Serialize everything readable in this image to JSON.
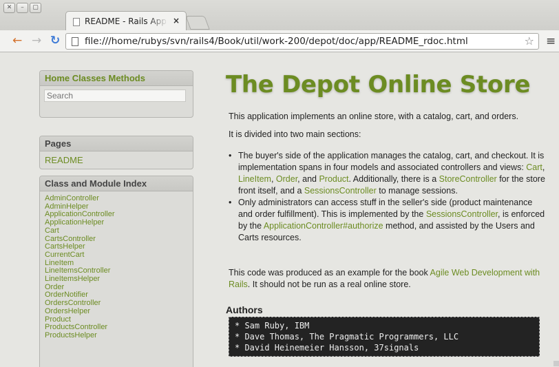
{
  "browser": {
    "window_controls": [
      "✕",
      "–",
      "▢"
    ],
    "tab_title": "README - Rails Applicatio",
    "tab_close": "×",
    "url": "file:///home/rubys/svn/rails4/Book/util/work-200/depot/doc/app/README_rdoc.html",
    "back_glyph": "←",
    "forward_glyph": "→",
    "reload_glyph": "↻",
    "star_glyph": "☆",
    "menu_glyph": "≡"
  },
  "sidebar": {
    "nav_title": "Home Classes Methods",
    "search_placeholder": "Search",
    "pages_title": "Pages",
    "pages": [
      "README"
    ],
    "index_title": "Class and Module Index",
    "classes": [
      "AdminController",
      "AdminHelper",
      "ApplicationController",
      "ApplicationHelper",
      "Cart",
      "CartsController",
      "CartsHelper",
      "CurrentCart",
      "LineItem",
      "LineItemsController",
      "LineItemsHelper",
      "Order",
      "OrderNotifier",
      "OrdersController",
      "OrdersHelper",
      "Product",
      "ProductsController",
      "ProductsHelper"
    ]
  },
  "main": {
    "title": "The Depot Online Store",
    "intro": "This application implements an online store, with a catalog, cart, and orders.",
    "divided": "It is divided into two main sections:",
    "bullet1": {
      "t1": "The buyer's side of the application manages the catalog, cart, and checkout. It is implementation spans in four models and associated controllers and views: ",
      "link_cart": "Cart",
      "sep1": ", ",
      "link_lineitem": "LineItem",
      "sep2": ", ",
      "link_order": "Order",
      "sep3": ", and ",
      "link_product": "Product",
      "t2": ". Additionally, there is a ",
      "link_storecontroller": "StoreController",
      "t3": " for the store front itself, and a ",
      "link_sessionscontroller": "SessionsController",
      "t4": " to manage sessions."
    },
    "bullet2": {
      "t1": "Only administrators can access stuff in the seller's side (product maintenance and order fulfillment). This is implemented by the ",
      "link_sessionscontroller": "SessionsController",
      "t2": ", is enforced by the ",
      "link_authorize": "ApplicationController#authorize",
      "t3": " method, and assisted by the Users and Carts resources."
    },
    "note": {
      "t1": "This code was produced as an example for the book ",
      "link_book": "Agile Web Development with Rails",
      "t2": ". It should not be run as a real online store."
    },
    "authors_title": "Authors",
    "authors": [
      "* Sam Ruby, IBM",
      "* Dave Thomas, The Pragmatic Programmers, LLC",
      "* David Heinemeier Hansson, 37signals"
    ]
  }
}
